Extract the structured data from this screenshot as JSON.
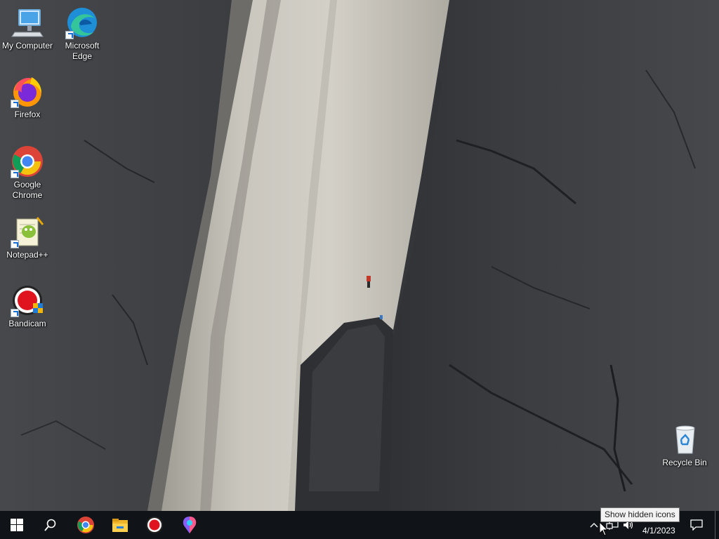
{
  "desktop": {
    "icons": [
      {
        "label": "My Computer",
        "icon": "computer-icon"
      },
      {
        "label": "Microsoft Edge",
        "icon": "edge-icon"
      },
      {
        "label": "Firefox",
        "icon": "firefox-icon"
      },
      {
        "label": "Google Chrome",
        "icon": "chrome-icon"
      },
      {
        "label": "Notepad++",
        "icon": "notepadpp-icon"
      },
      {
        "label": "Bandicam",
        "icon": "bandicam-icon"
      },
      {
        "label": "Recycle Bin",
        "icon": "recycle-bin-icon"
      }
    ],
    "edge_label_lines": [
      "Microsoft",
      "Edge"
    ],
    "chrome_label_lines": [
      "Google",
      "Chrome"
    ]
  },
  "taskbar": {
    "pinned": [
      "start-icon",
      "search-icon",
      "chrome-icon",
      "file-explorer-icon",
      "bandicam-icon",
      "paint-icon"
    ],
    "tray": {
      "tooltip": "Show hidden icons",
      "date": "4/1/2023"
    }
  },
  "colors": {
    "taskbar": "#101418",
    "start_blue": "#ffffff"
  }
}
